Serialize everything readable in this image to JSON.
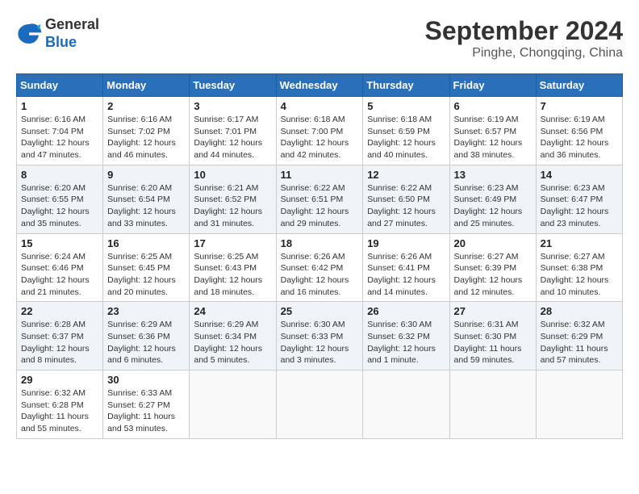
{
  "header": {
    "logo_general": "General",
    "logo_blue": "Blue",
    "month_year": "September 2024",
    "location": "Pinghe, Chongqing, China"
  },
  "calendar": {
    "days_of_week": [
      "Sunday",
      "Monday",
      "Tuesday",
      "Wednesday",
      "Thursday",
      "Friday",
      "Saturday"
    ],
    "weeks": [
      [
        {
          "day": "1",
          "info": "Sunrise: 6:16 AM\nSunset: 7:04 PM\nDaylight: 12 hours\nand 47 minutes."
        },
        {
          "day": "2",
          "info": "Sunrise: 6:16 AM\nSunset: 7:02 PM\nDaylight: 12 hours\nand 46 minutes."
        },
        {
          "day": "3",
          "info": "Sunrise: 6:17 AM\nSunset: 7:01 PM\nDaylight: 12 hours\nand 44 minutes."
        },
        {
          "day": "4",
          "info": "Sunrise: 6:18 AM\nSunset: 7:00 PM\nDaylight: 12 hours\nand 42 minutes."
        },
        {
          "day": "5",
          "info": "Sunrise: 6:18 AM\nSunset: 6:59 PM\nDaylight: 12 hours\nand 40 minutes."
        },
        {
          "day": "6",
          "info": "Sunrise: 6:19 AM\nSunset: 6:57 PM\nDaylight: 12 hours\nand 38 minutes."
        },
        {
          "day": "7",
          "info": "Sunrise: 6:19 AM\nSunset: 6:56 PM\nDaylight: 12 hours\nand 36 minutes."
        }
      ],
      [
        {
          "day": "8",
          "info": "Sunrise: 6:20 AM\nSunset: 6:55 PM\nDaylight: 12 hours\nand 35 minutes."
        },
        {
          "day": "9",
          "info": "Sunrise: 6:20 AM\nSunset: 6:54 PM\nDaylight: 12 hours\nand 33 minutes."
        },
        {
          "day": "10",
          "info": "Sunrise: 6:21 AM\nSunset: 6:52 PM\nDaylight: 12 hours\nand 31 minutes."
        },
        {
          "day": "11",
          "info": "Sunrise: 6:22 AM\nSunset: 6:51 PM\nDaylight: 12 hours\nand 29 minutes."
        },
        {
          "day": "12",
          "info": "Sunrise: 6:22 AM\nSunset: 6:50 PM\nDaylight: 12 hours\nand 27 minutes."
        },
        {
          "day": "13",
          "info": "Sunrise: 6:23 AM\nSunset: 6:49 PM\nDaylight: 12 hours\nand 25 minutes."
        },
        {
          "day": "14",
          "info": "Sunrise: 6:23 AM\nSunset: 6:47 PM\nDaylight: 12 hours\nand 23 minutes."
        }
      ],
      [
        {
          "day": "15",
          "info": "Sunrise: 6:24 AM\nSunset: 6:46 PM\nDaylight: 12 hours\nand 21 minutes."
        },
        {
          "day": "16",
          "info": "Sunrise: 6:25 AM\nSunset: 6:45 PM\nDaylight: 12 hours\nand 20 minutes."
        },
        {
          "day": "17",
          "info": "Sunrise: 6:25 AM\nSunset: 6:43 PM\nDaylight: 12 hours\nand 18 minutes."
        },
        {
          "day": "18",
          "info": "Sunrise: 6:26 AM\nSunset: 6:42 PM\nDaylight: 12 hours\nand 16 minutes."
        },
        {
          "day": "19",
          "info": "Sunrise: 6:26 AM\nSunset: 6:41 PM\nDaylight: 12 hours\nand 14 minutes."
        },
        {
          "day": "20",
          "info": "Sunrise: 6:27 AM\nSunset: 6:39 PM\nDaylight: 12 hours\nand 12 minutes."
        },
        {
          "day": "21",
          "info": "Sunrise: 6:27 AM\nSunset: 6:38 PM\nDaylight: 12 hours\nand 10 minutes."
        }
      ],
      [
        {
          "day": "22",
          "info": "Sunrise: 6:28 AM\nSunset: 6:37 PM\nDaylight: 12 hours\nand 8 minutes."
        },
        {
          "day": "23",
          "info": "Sunrise: 6:29 AM\nSunset: 6:36 PM\nDaylight: 12 hours\nand 6 minutes."
        },
        {
          "day": "24",
          "info": "Sunrise: 6:29 AM\nSunset: 6:34 PM\nDaylight: 12 hours\nand 5 minutes."
        },
        {
          "day": "25",
          "info": "Sunrise: 6:30 AM\nSunset: 6:33 PM\nDaylight: 12 hours\nand 3 minutes."
        },
        {
          "day": "26",
          "info": "Sunrise: 6:30 AM\nSunset: 6:32 PM\nDaylight: 12 hours\nand 1 minute."
        },
        {
          "day": "27",
          "info": "Sunrise: 6:31 AM\nSunset: 6:30 PM\nDaylight: 11 hours\nand 59 minutes."
        },
        {
          "day": "28",
          "info": "Sunrise: 6:32 AM\nSunset: 6:29 PM\nDaylight: 11 hours\nand 57 minutes."
        }
      ],
      [
        {
          "day": "29",
          "info": "Sunrise: 6:32 AM\nSunset: 6:28 PM\nDaylight: 11 hours\nand 55 minutes."
        },
        {
          "day": "30",
          "info": "Sunrise: 6:33 AM\nSunset: 6:27 PM\nDaylight: 11 hours\nand 53 minutes."
        },
        {
          "day": "",
          "info": ""
        },
        {
          "day": "",
          "info": ""
        },
        {
          "day": "",
          "info": ""
        },
        {
          "day": "",
          "info": ""
        },
        {
          "day": "",
          "info": ""
        }
      ]
    ]
  }
}
